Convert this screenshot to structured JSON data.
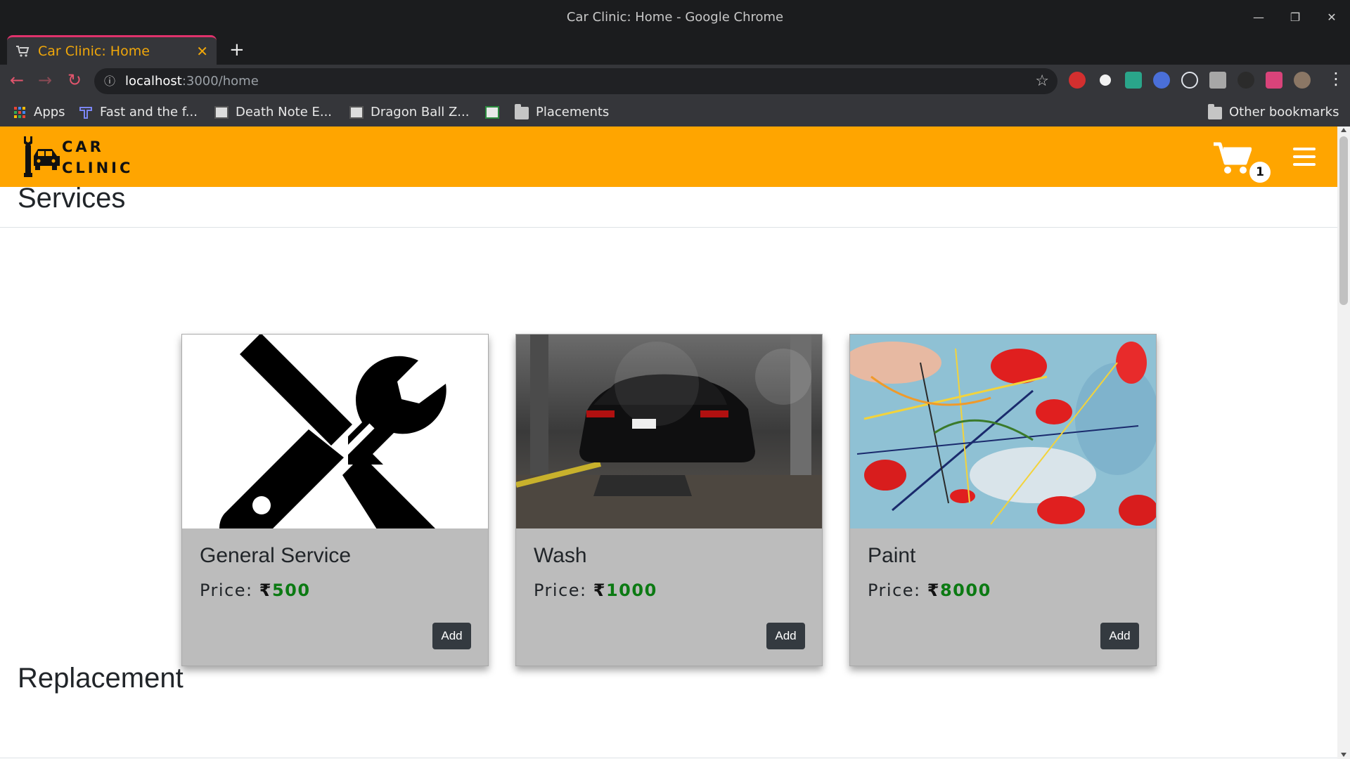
{
  "window": {
    "title": "Car Clinic: Home - Google Chrome"
  },
  "tab": {
    "title": "Car Clinic: Home"
  },
  "omnibox": {
    "host": "localhost",
    "path": ":3000/home"
  },
  "bookmarks": [
    {
      "label": "Apps"
    },
    {
      "label": "Fast and the f..."
    },
    {
      "label": "Death Note E..."
    },
    {
      "label": "Dragon Ball Z..."
    },
    {
      "label": ""
    },
    {
      "label": "Placements"
    }
  ],
  "other_bookmarks": "Other bookmarks",
  "navbar": {
    "brand_line1": "CAR",
    "brand_line2": "CLINIC",
    "cart_count": "1",
    "bg_color": "#ffa500"
  },
  "sections": [
    {
      "title": "Services"
    },
    {
      "title": "Replacement"
    }
  ],
  "services": [
    {
      "name": "General Service",
      "price_label": "Price:",
      "currency": "₹",
      "price": "500",
      "button": "Add",
      "image": "wrench-screwdriver-icon"
    },
    {
      "name": "Wash",
      "price_label": "Price:",
      "currency": "₹",
      "price": "1000",
      "button": "Add",
      "image": "car-wash-photo"
    },
    {
      "name": "Paint",
      "price_label": "Price:",
      "currency": "₹",
      "price": "8000",
      "button": "Add",
      "image": "abstract-paint-photo"
    }
  ]
}
